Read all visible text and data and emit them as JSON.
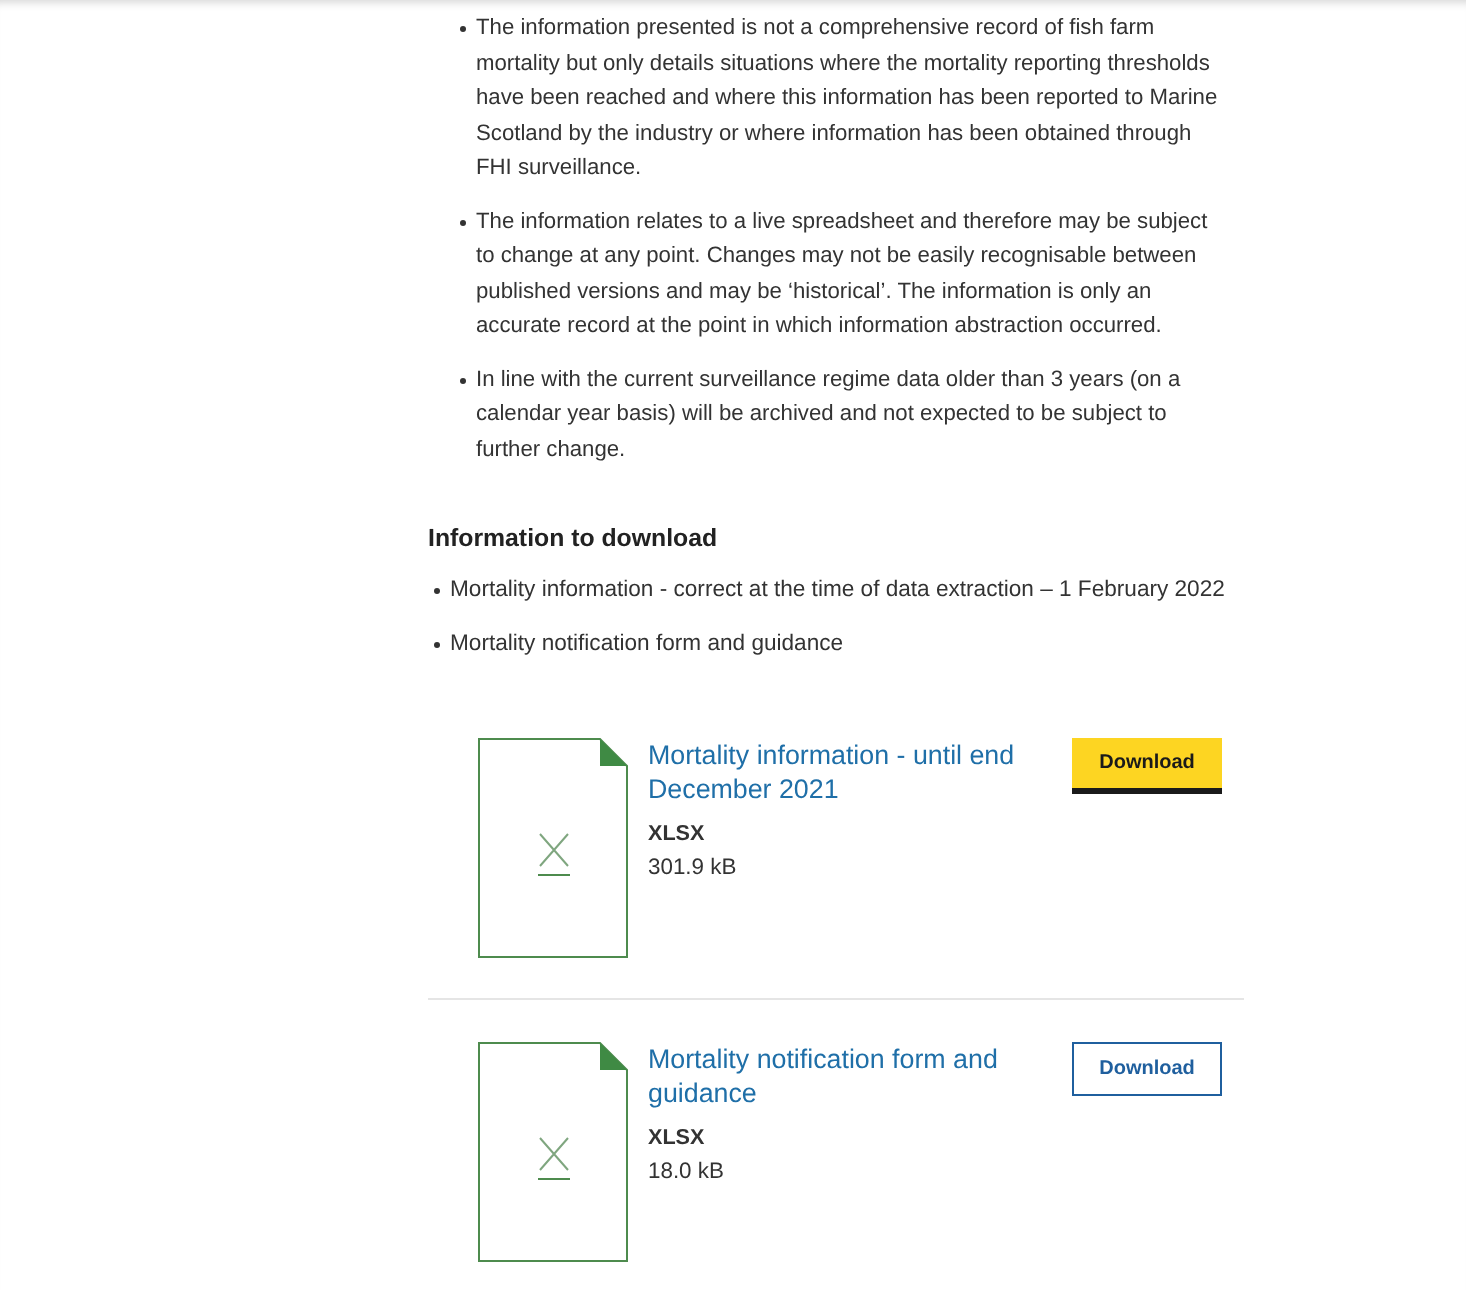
{
  "notes": [
    "The information presented is not a comprehensive record of fish farm mortality but only details situations where the mortality reporting thresholds have been reached and where this information has been reported to Marine Scotland by the industry or where information has been obtained through FHI surveillance.",
    "The information relates to a live spreadsheet and therefore may be subject to change at any point. Changes may not be easily recognisable between published versions and may be ‘historical’. The information is only an accurate record at the point in which information abstraction occurred.",
    "In line with the current surveillance regime data older than 3 years (on a calendar year basis) will be archived and not expected to be subject to further change."
  ],
  "download_section": {
    "heading": "Information to download",
    "items": [
      "Mortality information - correct at the time of data extraction – 1 February 2022",
      "Mortality notification form and guidance"
    ]
  },
  "documents": [
    {
      "title": "Mortality information - until end December 2021",
      "file_type": "XLSX",
      "file_size": "301.9 kB",
      "button": {
        "label": "Download",
        "kind": "primary"
      }
    },
    {
      "title": "Mortality notification form and guidance",
      "file_type": "XLSX",
      "file_size": "18.0 kB",
      "button": {
        "label": "Download",
        "kind": "secondary"
      }
    }
  ]
}
